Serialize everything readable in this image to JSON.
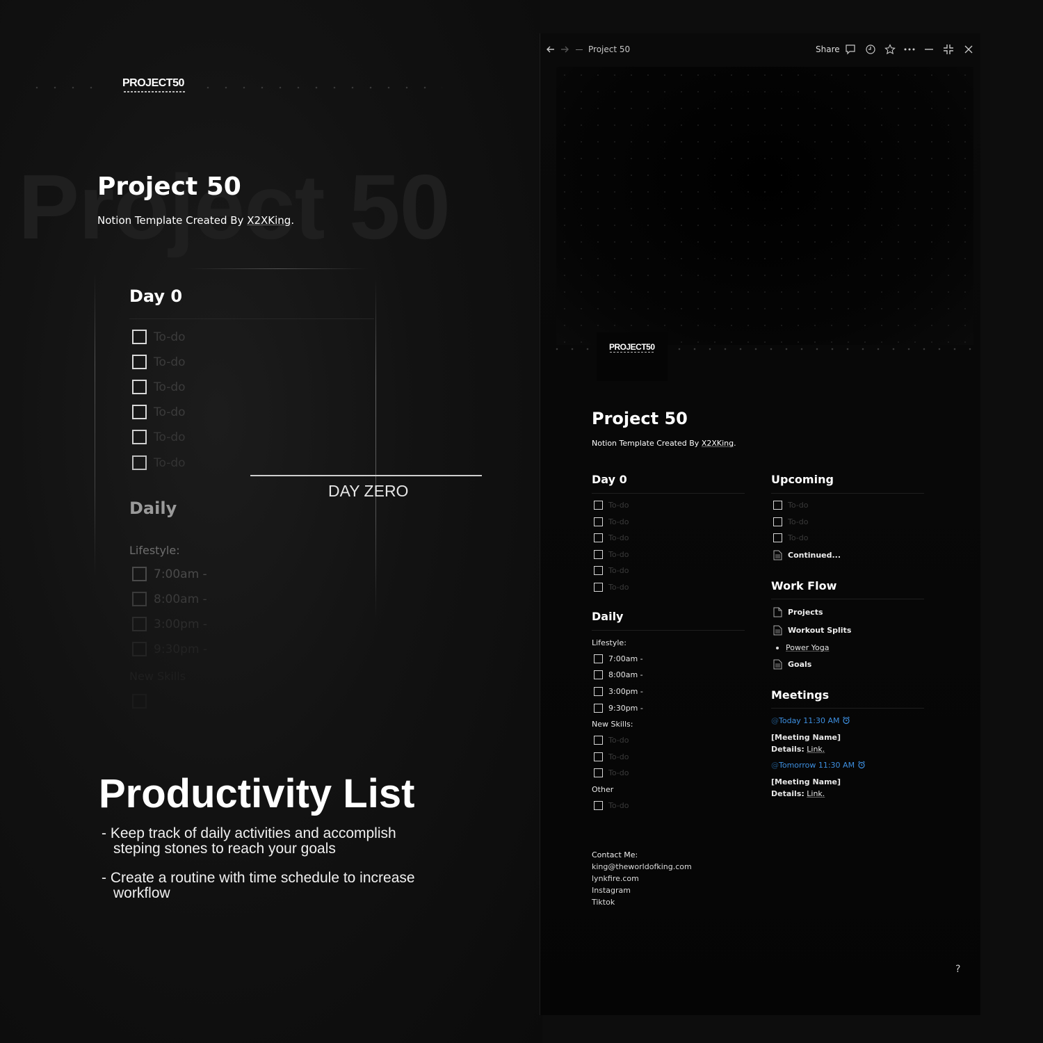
{
  "promo": {
    "logo": "PROJECT50",
    "ghost_text": "Project 50",
    "title": "Project 50",
    "subtitle_prefix": "Notion Template Created By ",
    "subtitle_author": "X2XKing",
    "subtitle_suffix": ".",
    "card": {
      "day_heading": "Day 0",
      "todos": [
        "To-do",
        "To-do",
        "To-do",
        "To-do",
        "To-do",
        "To-do"
      ],
      "daily_heading": "Daily",
      "lifestyle_label": "Lifestyle:",
      "lifestyle_items": [
        "7:00am -",
        "8:00am -",
        "3:00pm -",
        "9:30pm -"
      ],
      "new_skills_label": "New Skills"
    },
    "day_zero_label": "DAY ZERO",
    "heading": "Productivity List",
    "bullets": [
      {
        "line1": "- Keep track of daily activities and accomplish",
        "line2": "steping stones to reach your goals"
      },
      {
        "line1": "- Create a routine with time schedule to increase",
        "line2": "workflow"
      }
    ]
  },
  "app": {
    "toolbar": {
      "breadcrumb_title": "Project 50",
      "share_label": "Share",
      "icons": [
        "back-arrow-icon",
        "forward-arrow-icon",
        "comment-icon",
        "clock-icon",
        "star-icon",
        "more-icon",
        "minimize-icon",
        "exit-fullscreen-icon",
        "close-icon"
      ]
    },
    "page_icon_logo": "PROJECT50",
    "title": "Project 50",
    "subtitle_prefix": "Notion Template Created By ",
    "subtitle_author": "X2XKing",
    "subtitle_suffix": ".",
    "day0": {
      "heading": "Day 0",
      "todos": [
        "To-do",
        "To-do",
        "To-do",
        "To-do",
        "To-do",
        "To-do"
      ]
    },
    "daily": {
      "heading": "Daily",
      "lifestyle_label": "Lifestyle:",
      "lifestyle_items": [
        "7:00am -",
        "8:00am -",
        "3:00pm -",
        "9:30pm -"
      ],
      "new_skills_label": "New Skills:",
      "new_skills_todos": [
        "To-do",
        "To-do",
        "To-do"
      ],
      "other_label": "Other",
      "other_todos": [
        "To-do"
      ]
    },
    "upcoming": {
      "heading": "Upcoming",
      "todos": [
        "To-do",
        "To-do",
        "To-do"
      ],
      "page_link": "Continued..."
    },
    "workflow": {
      "heading": "Work Flow",
      "projects": "Projects",
      "workout": "Workout Splits",
      "yoga": "Power Yoga",
      "goals": "Goals"
    },
    "meetings": {
      "heading": "Meetings",
      "items": [
        {
          "date": "Today 11:30 AM",
          "name": "[Meeting Name]",
          "details_label": "Details:",
          "details_value": "Link."
        },
        {
          "date": "Tomorrow 11:30 AM",
          "name": "[Meeting Name]",
          "details_label": "Details:",
          "details_value": "Link."
        }
      ]
    },
    "contact": {
      "label": "Contact Me:",
      "email": "king@theworldofking.com",
      "site": "lynkfire.com",
      "instagram": "Instagram",
      "tiktok": "Tiktok"
    },
    "help_label": "?"
  },
  "colors": {
    "accent_blue": "#3d8fe0",
    "background": "#0d0d0d",
    "text": "#ffffff",
    "placeholder": "#3a3a3a"
  }
}
